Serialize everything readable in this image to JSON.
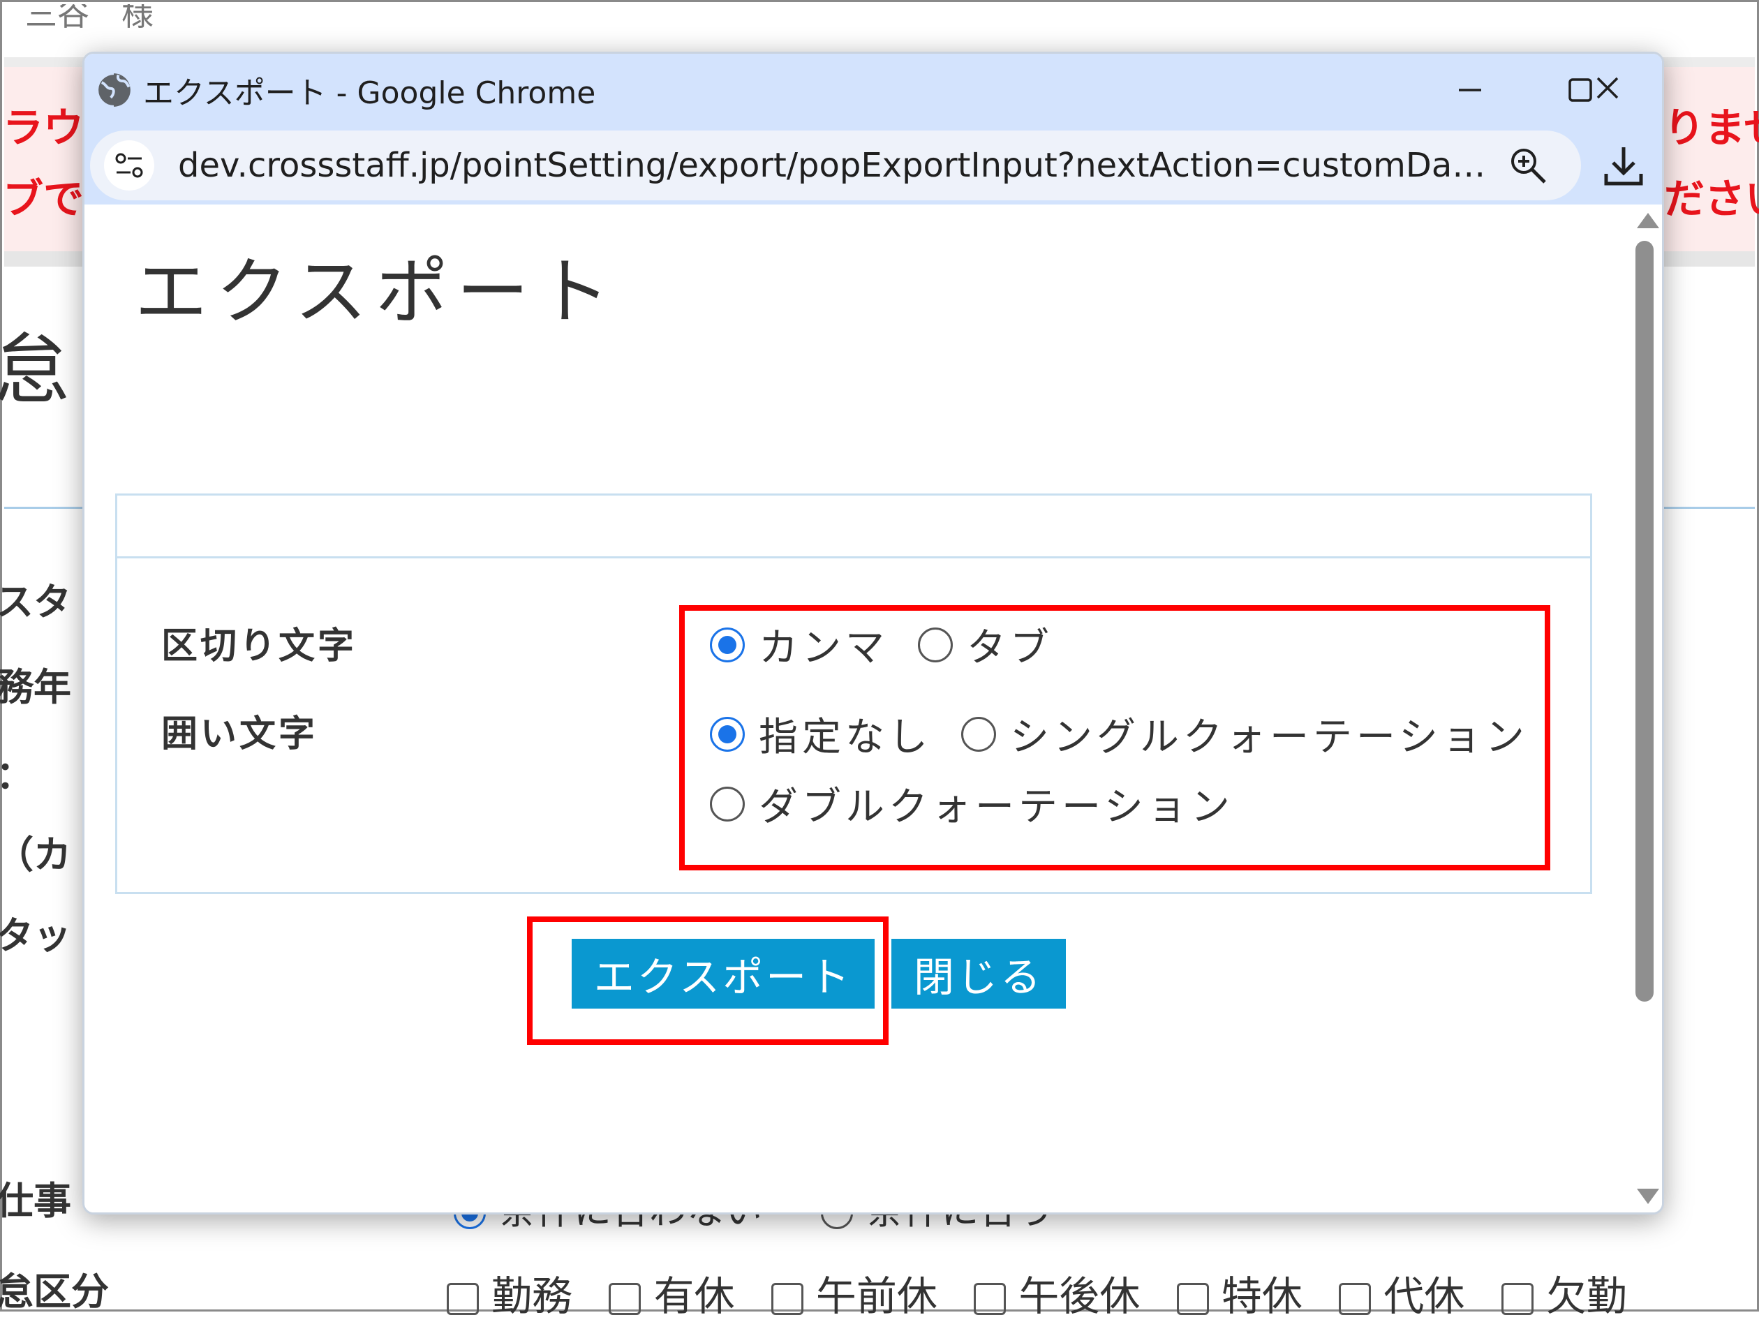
{
  "background": {
    "user_text": "三谷　様",
    "warn_left_lines": [
      "ラウ",
      "ブで"
    ],
    "warn_right_lines": [
      "りませ",
      "ださい"
    ],
    "title_fragment": "怠",
    "labels": [
      "スタ",
      "務年",
      "：",
      "（カ",
      "タッ",
      "仕事",
      "怠区分"
    ],
    "radio_options": [
      "条件に合わない",
      "条件に合う"
    ],
    "checkbox_options": [
      "勤務",
      "有休",
      "午前休",
      "午後休",
      "特休",
      "代休",
      "欠勤"
    ]
  },
  "window": {
    "title": "エクスポート - Google Chrome",
    "url": "dev.crossstaff.jp/pointSetting/export/popExportInput?nextAction=customDataOutputAction"
  },
  "page": {
    "title": "エクスポート",
    "delimiter": {
      "label": "区切り文字",
      "options": [
        {
          "label": "カンマ",
          "checked": true
        },
        {
          "label": "タブ",
          "checked": false
        }
      ]
    },
    "enclosure": {
      "label": "囲い文字",
      "options": [
        {
          "label": "指定なし",
          "checked": true
        },
        {
          "label": "シングルクォーテーション",
          "checked": false
        },
        {
          "label": "ダブルクォーテーション",
          "checked": false
        }
      ]
    },
    "buttons": {
      "export": "エクスポート",
      "close": "閉じる"
    }
  },
  "colors": {
    "highlight": "#ff0000",
    "button": "#0a98d0",
    "radio_checked": "#1a73e8",
    "warning_text": "#e8141c"
  }
}
